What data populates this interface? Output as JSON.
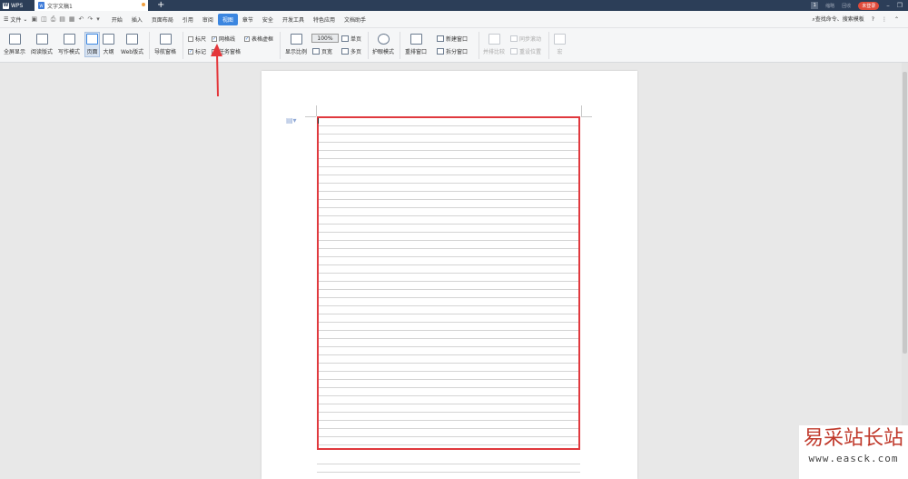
{
  "titlebar": {
    "app_tab": "WPS",
    "doc_tab": "文字文稿1",
    "add_tab": "+",
    "sync": "1",
    "sync_label": "缩略",
    "backup_label": "回收",
    "login_label": "未登录",
    "minimize": "–",
    "restore": "❐"
  },
  "menubar": {
    "file": "文件",
    "items": [
      "开始",
      "插入",
      "页面布局",
      "引用",
      "审阅",
      "视图",
      "章节",
      "安全",
      "开发工具",
      "特色应用",
      "文档助手"
    ],
    "active": "视图",
    "search": "查找命令、搜索模板",
    "help": "?"
  },
  "ribbon": {
    "view_buttons": [
      "全屏显示",
      "阅读版式",
      "写作模式",
      "页面",
      "大纲",
      "Web版式"
    ],
    "nav_pane": "导航窗格",
    "checks": [
      {
        "label": "标尺",
        "checked": false
      },
      {
        "label": "网格线",
        "checked": true
      },
      {
        "label": "标记",
        "checked": true
      },
      {
        "label": "任务窗格",
        "checked": false
      },
      {
        "label": "表格虚框",
        "checked": true
      }
    ],
    "zoom_label": "显示比例",
    "zoom_value": "100%",
    "page_width": "页宽",
    "single_page": "单页",
    "multi_page": "多页",
    "eye_mode": "护眼模式",
    "arrange": "重排窗口",
    "new_window": "新建窗口",
    "split_window": "拆分窗口",
    "side_by_side": "并排比较",
    "sync_scroll": "同步滚动",
    "reset_pos": "重设位置",
    "macro": "宏"
  },
  "watermark": {
    "line1": "易采站长站",
    "line2": "www.easck.com"
  }
}
